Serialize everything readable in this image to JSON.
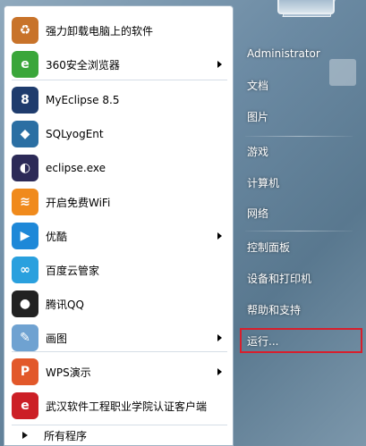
{
  "programs": [
    {
      "label": "强力卸载电脑上的软件",
      "icon": "recycle-icon",
      "color": "#c8732a",
      "glyph": "♻",
      "arrow": false
    },
    {
      "label": "360安全浏览器",
      "icon": "browser-360-icon",
      "color": "#3aa63a",
      "glyph": "e",
      "arrow": true
    },
    {
      "label": "MyEclipse 8.5",
      "icon": "myeclipse-icon",
      "color": "#1f3c6d",
      "glyph": "8",
      "arrow": false
    },
    {
      "label": "SQLyogEnt",
      "icon": "dolphin-icon",
      "color": "#2b6fa3",
      "glyph": "◆",
      "arrow": false
    },
    {
      "label": "eclipse.exe",
      "icon": "eclipse-icon",
      "color": "#2c2a57",
      "glyph": "◐",
      "arrow": false
    },
    {
      "label": "开启免费WiFi",
      "icon": "wifi-icon",
      "color": "#f08a1c",
      "glyph": "≋",
      "arrow": false
    },
    {
      "label": "优酷",
      "icon": "youku-icon",
      "color": "#1e88d8",
      "glyph": "▶",
      "arrow": true
    },
    {
      "label": "百度云管家",
      "icon": "cloud-icon",
      "color": "#2aa0de",
      "glyph": "∞",
      "arrow": false
    },
    {
      "label": "腾讯QQ",
      "icon": "qq-penguin-icon",
      "color": "#222222",
      "glyph": "●",
      "arrow": false
    },
    {
      "label": "画图",
      "icon": "paint-palette-icon",
      "color": "#6fa2d1",
      "glyph": "✎",
      "arrow": true
    },
    {
      "label": "WPS演示",
      "icon": "wps-icon",
      "color": "#e2582a",
      "glyph": "P",
      "arrow": true
    },
    {
      "label": "武汉软件工程职业学院认证客户端",
      "icon": "auth-client-icon",
      "color": "#cc1f26",
      "glyph": "e",
      "arrow": false
    }
  ],
  "all_programs": "所有程序",
  "right_items": [
    {
      "label": "Administrator",
      "name": "rp-administrator"
    },
    {
      "label": "文档",
      "name": "rp-documents"
    },
    {
      "label": "图片",
      "name": "rp-pictures"
    },
    {
      "label": "游戏",
      "name": "rp-games"
    },
    {
      "label": "计算机",
      "name": "rp-computer"
    },
    {
      "label": "网络",
      "name": "rp-network"
    },
    {
      "label": "控制面板",
      "name": "rp-control-panel"
    },
    {
      "label": "设备和打印机",
      "name": "rp-devices-printers"
    },
    {
      "label": "帮助和支持",
      "name": "rp-help-support"
    },
    {
      "label": "运行...",
      "name": "rp-run"
    }
  ],
  "highlight_color": "#d81e2c"
}
